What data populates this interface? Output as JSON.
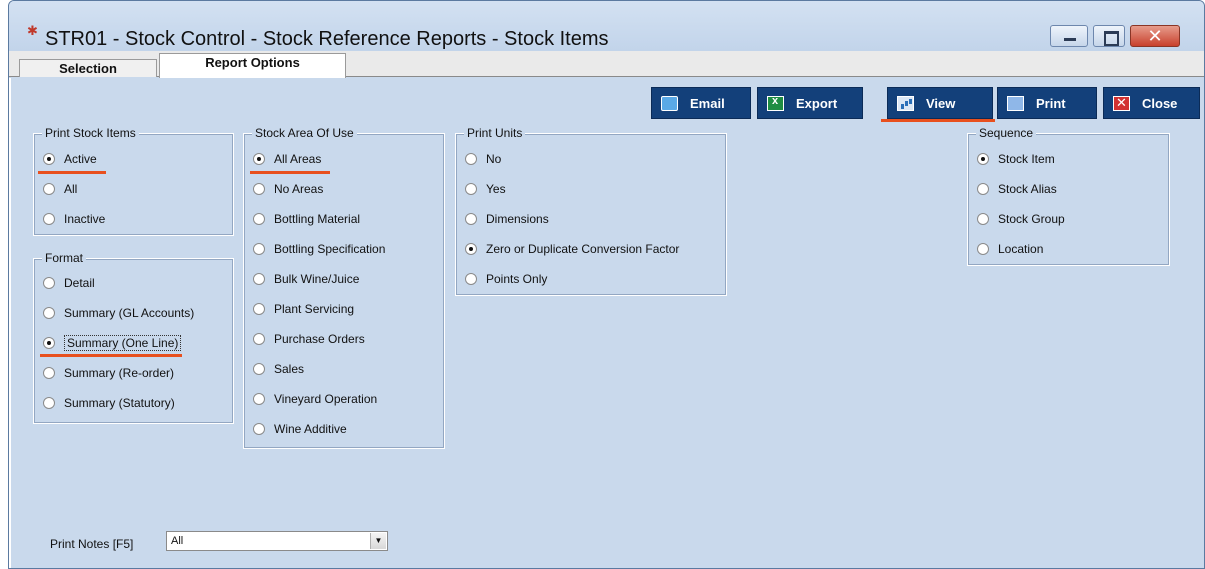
{
  "window": {
    "title": "STR01 - Stock Control - Stock Reference Reports - Stock Items",
    "close_label": "✕"
  },
  "tabs": [
    {
      "label": "Selection"
    },
    {
      "label": "Report Options"
    }
  ],
  "toolbar": {
    "email": "Email",
    "export": "Export",
    "view": "View",
    "print": "Print",
    "close": "Close"
  },
  "print_stock_items": {
    "legend": "Print Stock Items",
    "options": [
      "Active",
      "All",
      "Inactive"
    ],
    "selected": "Active"
  },
  "format": {
    "legend": "Format",
    "options": [
      "Detail",
      "Summary (GL Accounts)",
      "Summary (One Line)",
      "Summary (Re-order)",
      "Summary (Statutory)"
    ],
    "selected": "Summary (One Line)"
  },
  "stock_area": {
    "legend": "Stock Area Of Use",
    "options": [
      "All Areas",
      "No Areas",
      "Bottling Material",
      "Bottling Specification",
      "Bulk Wine/Juice",
      "Plant Servicing",
      "Purchase Orders",
      "Sales",
      "Vineyard Operation",
      "Wine Additive"
    ],
    "selected": "All Areas"
  },
  "print_units": {
    "legend": "Print Units",
    "options": [
      "No",
      "Yes",
      "Dimensions",
      "Zero or Duplicate Conversion Factor",
      "Points Only"
    ],
    "selected": "Zero or Duplicate Conversion Factor"
  },
  "sequence": {
    "legend": "Sequence",
    "options": [
      "Stock Item",
      "Stock Alias",
      "Stock Group",
      "Location"
    ],
    "selected": "Stock Item"
  },
  "print_notes": {
    "label": "Print Notes [F5]",
    "value": "All",
    "arrow": "▼"
  },
  "colors": {
    "background": "#c9d9ec",
    "toolbar_button": "#13407a",
    "highlight": "#e8501e"
  }
}
